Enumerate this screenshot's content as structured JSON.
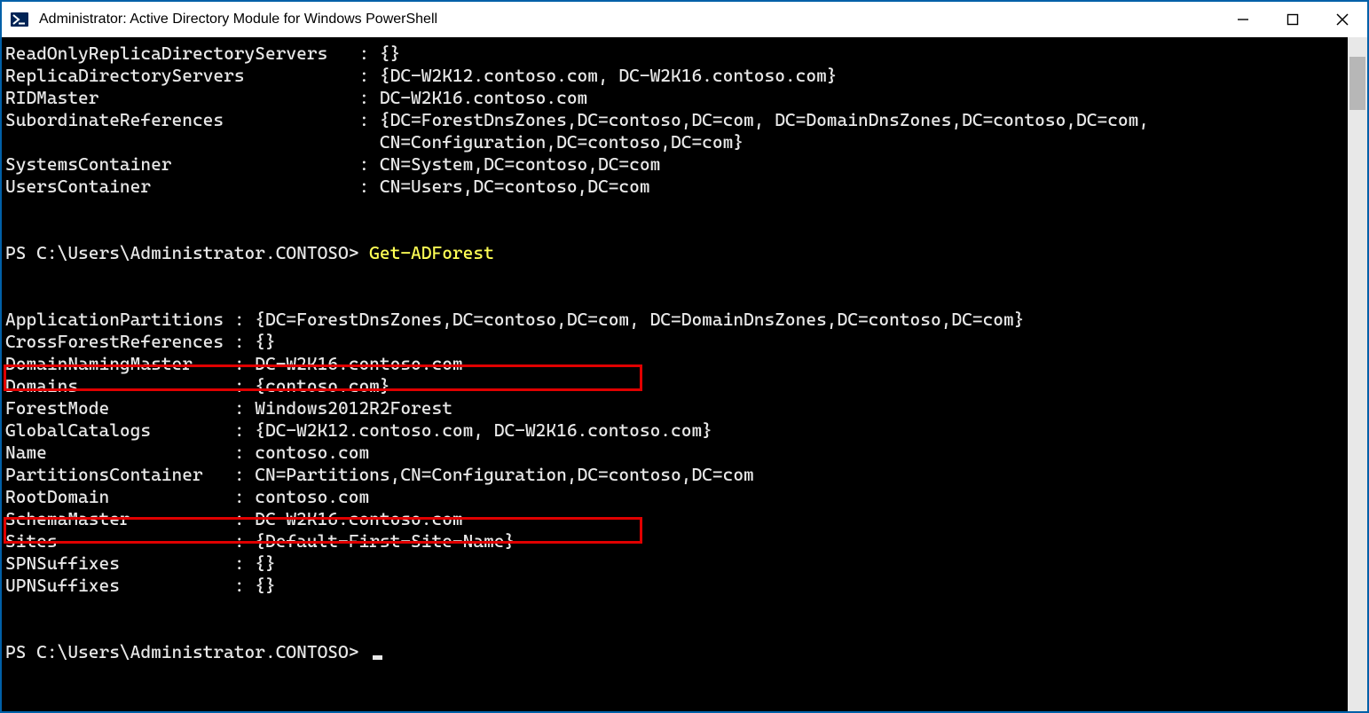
{
  "window": {
    "title": "Administrator: Active Directory Module for Windows PowerShell"
  },
  "top_block": {
    "lines": [
      {
        "k": "ReadOnlyReplicaDirectoryServers",
        "v": "{}"
      },
      {
        "k": "ReplicaDirectoryServers",
        "v": "{DC-W2K12.contoso.com, DC-W2K16.contoso.com}"
      },
      {
        "k": "RIDMaster",
        "v": "DC-W2K16.contoso.com"
      },
      {
        "k": "SubordinateReferences",
        "v": "{DC=ForestDnsZones,DC=contoso,DC=com, DC=DomainDnsZones,DC=contoso,DC=com,",
        "v2": "CN=Configuration,DC=contoso,DC=com}"
      },
      {
        "k": "SystemsContainer",
        "v": "CN=System,DC=contoso,DC=com"
      },
      {
        "k": "UsersContainer",
        "v": "CN=Users,DC=contoso,DC=com"
      }
    ],
    "key_width": 33
  },
  "prompt1": {
    "ps": "PS C:\\Users\\Administrator.CONTOSO> ",
    "cmd": "Get-ADForest"
  },
  "forest_block": {
    "lines": [
      {
        "k": "ApplicationPartitions",
        "v": "{DC=ForestDnsZones,DC=contoso,DC=com, DC=DomainDnsZones,DC=contoso,DC=com}"
      },
      {
        "k": "CrossForestReferences",
        "v": "{}"
      },
      {
        "k": "DomainNamingMaster",
        "v": "DC-W2K16.contoso.com"
      },
      {
        "k": "Domains",
        "v": "{contoso.com}"
      },
      {
        "k": "ForestMode",
        "v": "Windows2012R2Forest"
      },
      {
        "k": "GlobalCatalogs",
        "v": "{DC-W2K12.contoso.com, DC-W2K16.contoso.com}"
      },
      {
        "k": "Name",
        "v": "contoso.com"
      },
      {
        "k": "PartitionsContainer",
        "v": "CN=Partitions,CN=Configuration,DC=contoso,DC=com"
      },
      {
        "k": "RootDomain",
        "v": "contoso.com"
      },
      {
        "k": "SchemaMaster",
        "v": "DC-W2K16.contoso.com"
      },
      {
        "k": "Sites",
        "v": "{Default-First-Site-Name}"
      },
      {
        "k": "SPNSuffixes",
        "v": "{}"
      },
      {
        "k": "UPNSuffixes",
        "v": "{}"
      }
    ],
    "key_width": 21
  },
  "prompt2": {
    "ps": "PS C:\\Users\\Administrator.CONTOSO> "
  }
}
